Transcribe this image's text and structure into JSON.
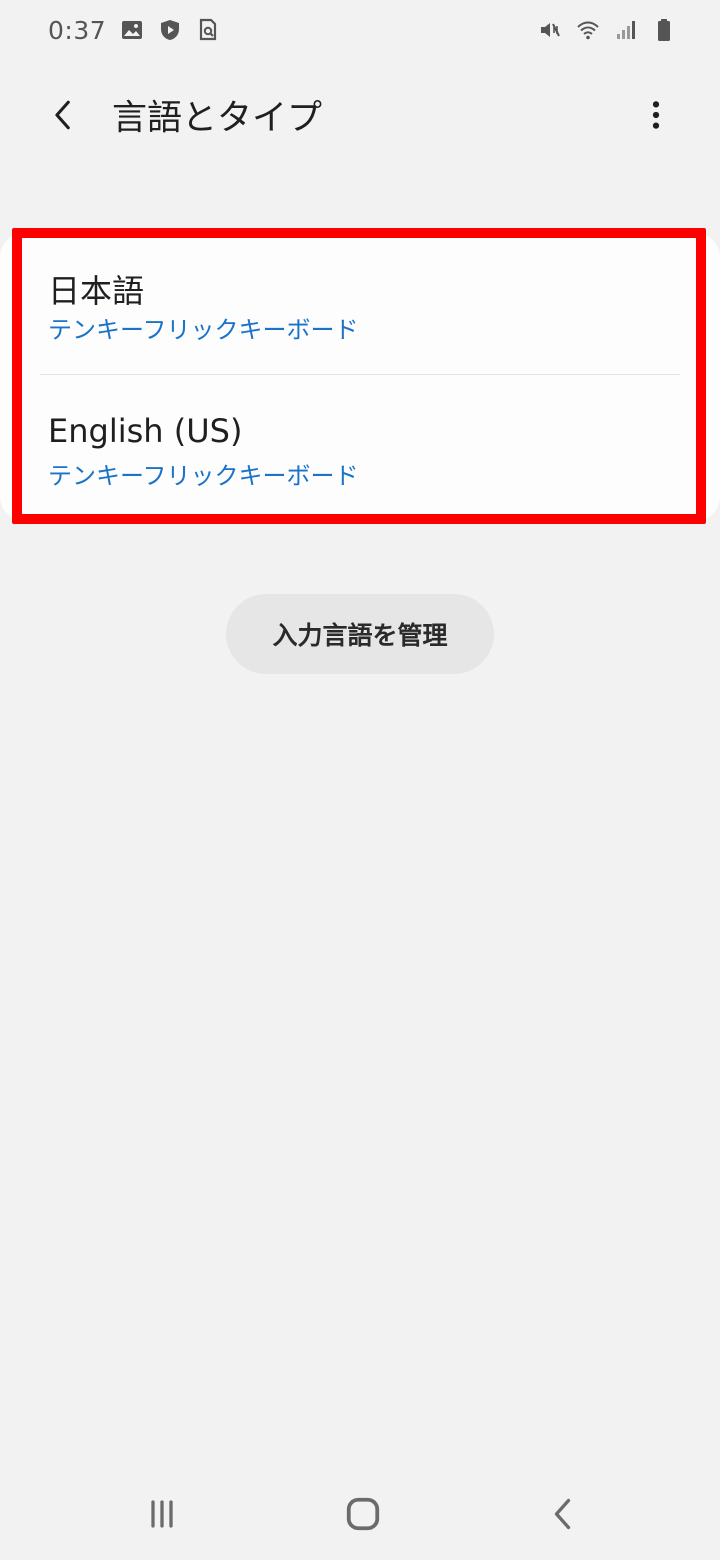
{
  "status_bar": {
    "time": "0:37",
    "left_icons": [
      "image-icon",
      "shield-play-icon",
      "search-page-icon"
    ],
    "right_icons": [
      "mute-icon",
      "wifi-icon",
      "signal-icon",
      "battery-icon"
    ]
  },
  "app_bar": {
    "title": "言語とタイプ",
    "back_icon": "back-chevron-icon",
    "more_icon": "more-vert-icon"
  },
  "languages": [
    {
      "name": "日本語",
      "keyboard": "テンキーフリックキーボード"
    },
    {
      "name": "English (US)",
      "keyboard": "テンキーフリックキーボード"
    }
  ],
  "manage_button": {
    "label": "入力言語を管理"
  },
  "nav_bar": {
    "icons": [
      "recents-icon",
      "home-icon",
      "back-icon"
    ]
  },
  "colors": {
    "background": "#f2f2f2",
    "card": "#fdfdfd",
    "accent_text": "#1a73c9",
    "highlight_outline": "#ff0000",
    "button_bg": "#e6e6e6"
  }
}
